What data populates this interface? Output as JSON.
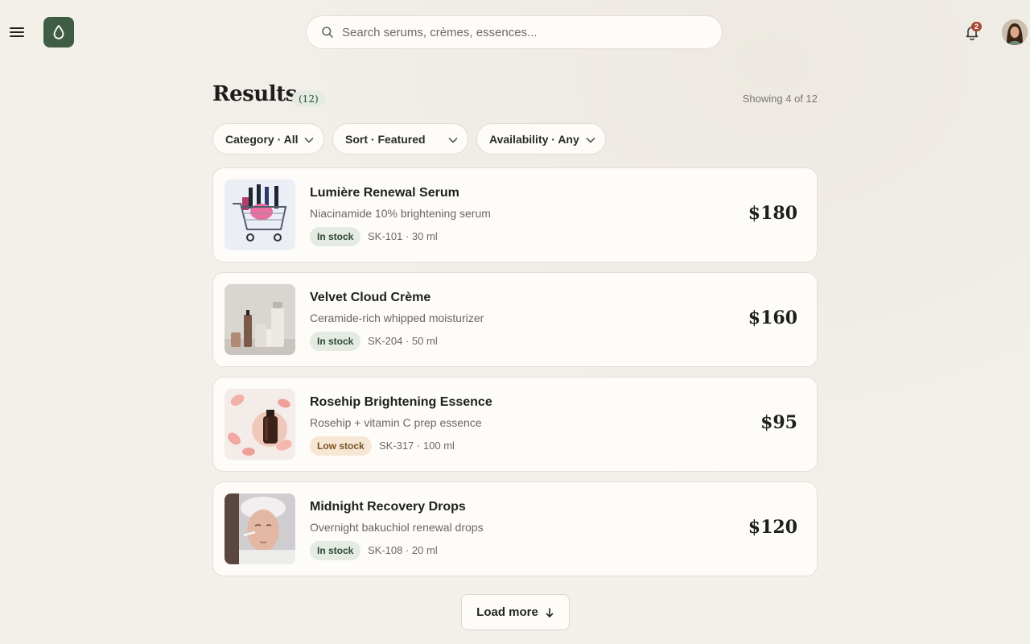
{
  "header": {
    "search_placeholder": "Search serums, crèmes, essences...",
    "notification_count": "2"
  },
  "results": {
    "title": "Results",
    "count": "(12)",
    "showing": "Showing 4 of 12"
  },
  "filters": [
    {
      "label": "Category · All"
    },
    {
      "label": "Sort · Featured"
    },
    {
      "label": "Availability · Any"
    }
  ],
  "products": [
    {
      "name": "Lumière Renewal Serum",
      "desc": "Niacinamide 10% brightening serum",
      "stock": "In stock",
      "sku": "SK-101 · 30 ml",
      "price": "$180"
    },
    {
      "name": "Velvet Cloud Crème",
      "desc": "Ceramide-rich whipped moisturizer",
      "stock": "In stock",
      "sku": "SK-204 · 50 ml",
      "price": "$160"
    },
    {
      "name": "Rosehip Brightening Essence",
      "desc": "Rosehip + vitamin C prep essence",
      "stock": "Low stock",
      "sku": "SK-317 · 100 ml",
      "price": "$95"
    },
    {
      "name": "Midnight Recovery Drops",
      "desc": "Overnight bakuchiol renewal drops",
      "stock": "In stock",
      "sku": "SK-108 · 20 ml",
      "price": "$120"
    }
  ],
  "load_more": {
    "label": "Load more"
  },
  "colors": {
    "brand": "#3f5d45",
    "background": "#f3f0ea",
    "in_stock_bg": "#e3ebe2",
    "low_stock_bg": "#f6e7d4",
    "notification": "#a54a35"
  }
}
